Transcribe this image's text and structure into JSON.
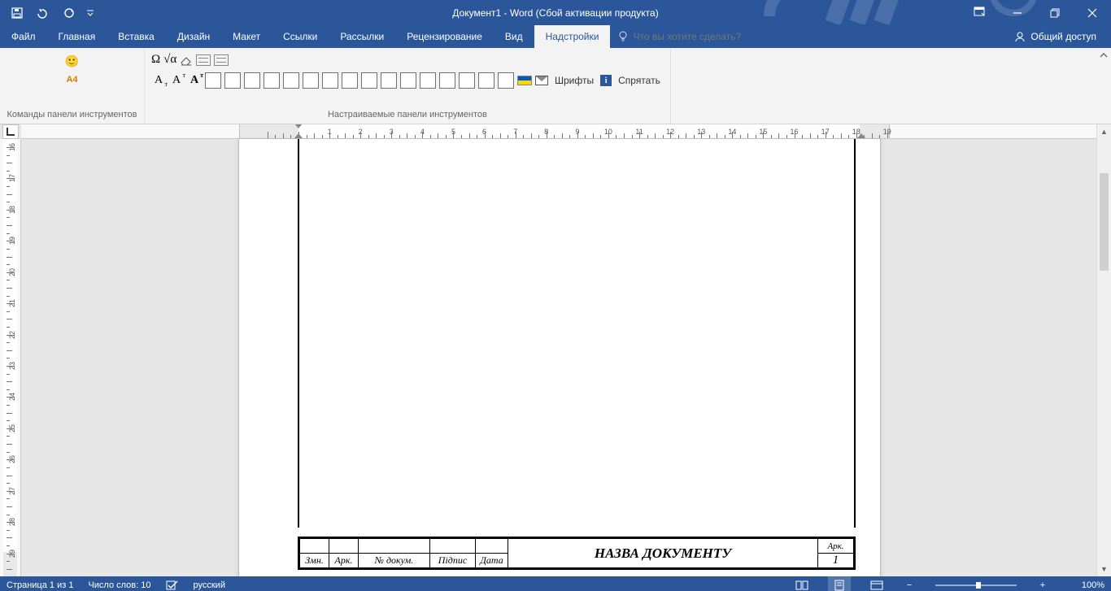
{
  "titlebar": {
    "title": "Документ1 - Word (Сбой активации продукта)"
  },
  "tabs": {
    "file": "Файл",
    "items": [
      "Главная",
      "Вставка",
      "Дизайн",
      "Макет",
      "Ссылки",
      "Рассылки",
      "Рецензирование",
      "Вид",
      "Надстройки"
    ],
    "active_index": 8,
    "tell_me_placeholder": "Что вы хотите сделать?",
    "share": "Общий доступ"
  },
  "ribbon": {
    "group1_label": "Команды панели инструментов",
    "group1_a4": "A4",
    "group2_label": "Настраиваемые панели инструментов",
    "fonts_label": "Шрифты",
    "hide_label": "Спрятать"
  },
  "document": {
    "title_block": {
      "name": "НАЗВА ДОКУМЕНТУ",
      "ark_label": "Арк.",
      "page_num": "1",
      "col_zmn": "Змн.",
      "col_ark": "Арк.",
      "col_doc": "№ докум.",
      "col_sign": "Підпис",
      "col_date": "Дата"
    }
  },
  "statusbar": {
    "page": "Страница 1 из 1",
    "words": "Число слов: 10",
    "lang": "русский",
    "zoom": "100%"
  }
}
